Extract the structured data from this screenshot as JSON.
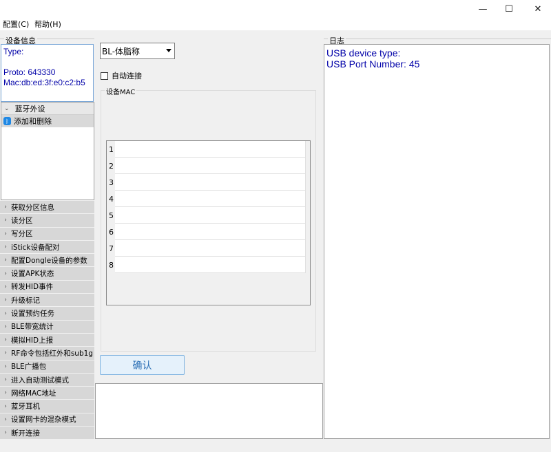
{
  "window": {
    "minimize": "—",
    "maximize": "☐",
    "close": "✕"
  },
  "menu": {
    "config": "配置(C)",
    "help": "帮助(H)"
  },
  "device_info": {
    "label": "设备信息",
    "type": "Type:",
    "proto": "Proto: 643330",
    "mac": "Mac:db:ed:3f:e0:c2:b5"
  },
  "tree": {
    "header": "蓝牙外设",
    "item": "添加和删除"
  },
  "nav": {
    "items": [
      "获取分区信息",
      "读分区",
      "写分区",
      "iStick设备配对",
      "配置Dongle设备的参数",
      "设置APK状态",
      "转发HID事件",
      "升级标记",
      "设置预约任务",
      "BLE带宽统计",
      "模拟HID上报",
      "RF命令包括红外和sub1g",
      "BLE广播包",
      "进入自动测试模式",
      "网络MAC地址",
      "蓝牙耳机",
      "设置网卡的混杂模式",
      "断开连接"
    ]
  },
  "form": {
    "device_select": "BL-体脂称",
    "auto_connect": "自动连接",
    "mac_group_label": "设备MAC",
    "rows": [
      "1",
      "2",
      "3",
      "4",
      "5",
      "6",
      "7",
      "8"
    ],
    "confirm": "确认"
  },
  "log": {
    "label": "日志",
    "lines": [
      "USB device type:",
      "USB Port Number: 45"
    ]
  }
}
